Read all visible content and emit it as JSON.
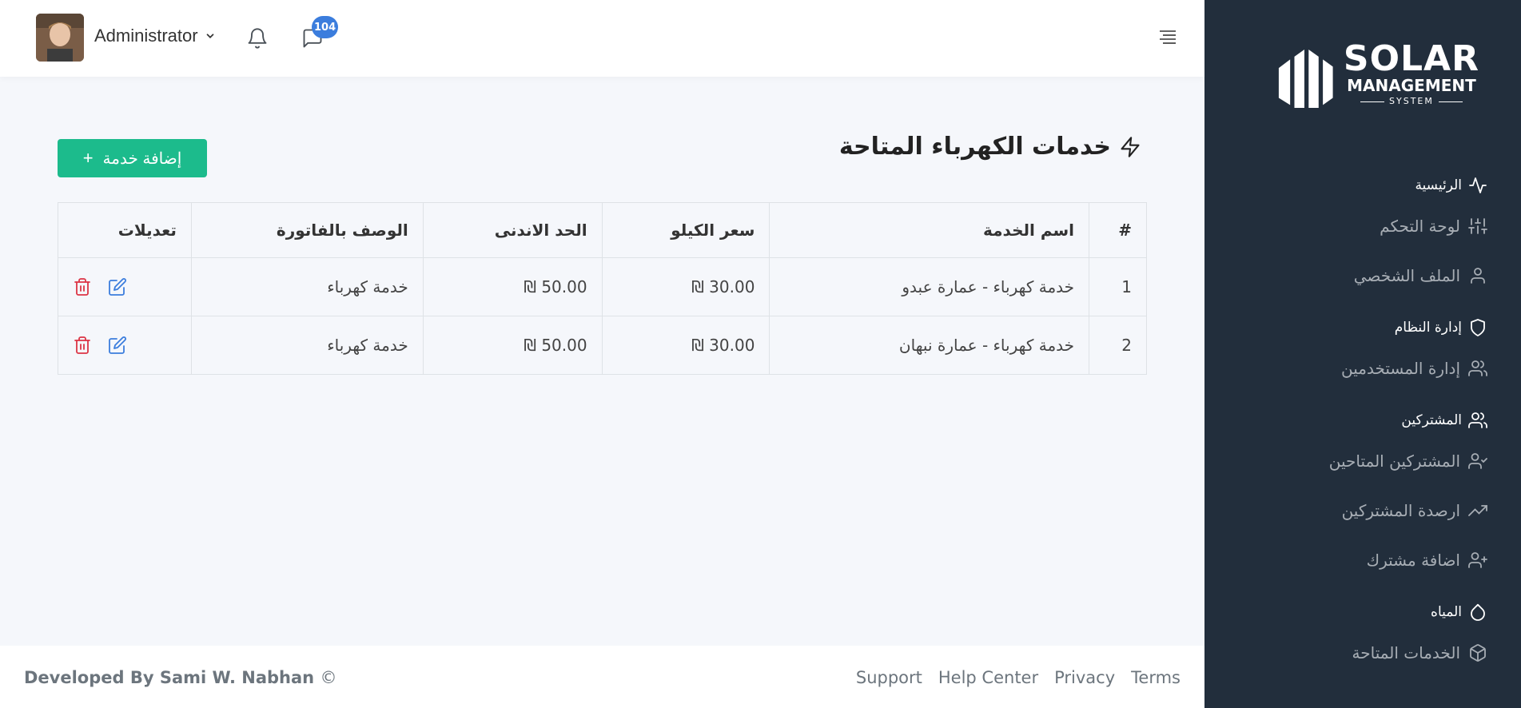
{
  "brand": {
    "logo_line1": "SOLAR",
    "logo_line2": "MANAGEMENT",
    "logo_line3": "SYSTEM"
  },
  "sidebar": {
    "sections": [
      {
        "header": "الرئيسية",
        "icon": "activity-icon",
        "items": [
          {
            "label": "لوحة التحكم",
            "icon": "sliders-icon"
          },
          {
            "label": "الملف الشخصي",
            "icon": "user-icon"
          }
        ]
      },
      {
        "header": "إدارة النظام",
        "icon": "shield-icon",
        "items": [
          {
            "label": "إدارة المستخدمين",
            "icon": "users-icon"
          }
        ]
      },
      {
        "header": "المشتركين",
        "icon": "users-icon",
        "items": [
          {
            "label": "المشتركين المتاحين",
            "icon": "user-check-icon"
          },
          {
            "label": "ارصدة المشتركين",
            "icon": "trending-up-icon"
          },
          {
            "label": "اضافة مشترك",
            "icon": "user-plus-icon"
          }
        ]
      },
      {
        "header": "المياه",
        "icon": "droplet-icon",
        "items": [
          {
            "label": "الخدمات المتاحة",
            "icon": "package-icon"
          }
        ]
      }
    ]
  },
  "topbar": {
    "user_name": "Administrator",
    "messages_badge": "104"
  },
  "page": {
    "title": "خدمات الكهرباء المتاحة",
    "add_button": "إضافة خدمة",
    "add_button_icon": "+"
  },
  "table": {
    "headers": [
      "#",
      "اسم الخدمة",
      "سعر الكيلو",
      "الحد الاندنى",
      "الوصف بالفاتورة",
      "تعديلات"
    ],
    "rows": [
      {
        "num": "1",
        "name": "خدمة كهرباء - عمارة عبدو",
        "price": "30.00 ₪",
        "min": "50.00 ₪",
        "desc": "خدمة كهرباء"
      },
      {
        "num": "2",
        "name": "خدمة كهرباء - عمارة نبهان",
        "price": "30.00 ₪",
        "min": "50.00 ₪",
        "desc": "خدمة كهرباء"
      }
    ]
  },
  "footer": {
    "developer": "Developed By Sami W. Nabhan",
    "copyright": "©",
    "links": [
      "Support",
      "Help Center",
      "Privacy",
      "Terms"
    ]
  },
  "colors": {
    "sidebar_bg": "#222e3c",
    "primary": "#3b7ddd",
    "success": "#1cbb8c",
    "danger": "#dc3545"
  }
}
